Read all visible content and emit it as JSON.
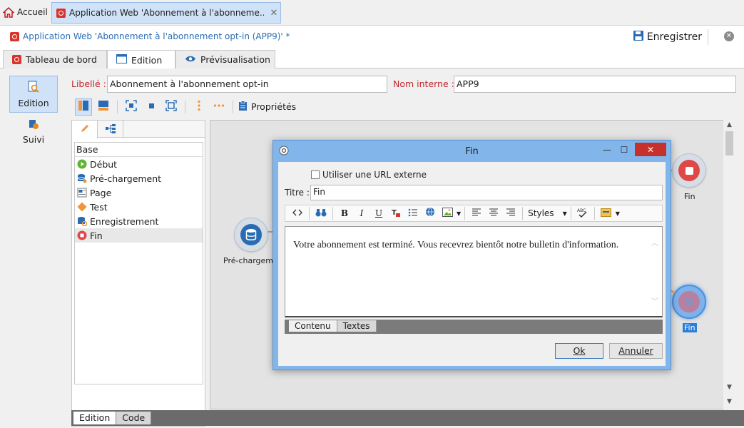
{
  "topbar": {
    "home_label": "Accueil",
    "tab_title": "Application Web 'Abonnement à l'abonneme...",
    "tab_close": "✕"
  },
  "titlebar": {
    "document_title": "Application Web 'Abonnement à l'abonnement opt-in (APP9)' *",
    "save_label": "Enregistrer"
  },
  "main_tabs": [
    {
      "label": "Tableau de bord",
      "icon": "dashboard-icon",
      "active": false
    },
    {
      "label": "Edition",
      "icon": "window-icon",
      "active": true
    },
    {
      "label": "Prévisualisation",
      "icon": "eye-icon",
      "active": false
    }
  ],
  "left_nav": [
    {
      "label": "Edition",
      "icon": "edit-search-icon",
      "active": true
    },
    {
      "label": "Suivi",
      "icon": "tracking-icon",
      "active": false
    }
  ],
  "form": {
    "libelle_label": "Libellé :",
    "libelle_value": "Abonnement à l'abonnement opt-in",
    "nom_interne_label": "Nom interne :",
    "nom_interne_value": "APP9"
  },
  "toolbar": {
    "properties_label": "Propriétés"
  },
  "activity_list": {
    "header": "Base",
    "items": [
      {
        "label": "Début",
        "icon": "start-icon"
      },
      {
        "label": "Pré-chargement",
        "icon": "preload-icon"
      },
      {
        "label": "Page",
        "icon": "page-icon"
      },
      {
        "label": "Test",
        "icon": "test-diamond-icon"
      },
      {
        "label": "Enregistrement",
        "icon": "save-record-icon"
      },
      {
        "label": "Fin",
        "icon": "end-icon",
        "selected": true
      }
    ]
  },
  "bottom_tabs": [
    {
      "label": "Edition",
      "active": true
    },
    {
      "label": "Code",
      "active": false
    }
  ],
  "canvas": {
    "node_preload_label": "Pré-chargeme",
    "node_end_top_label": "Fin",
    "node_end_selected_label": "Fin"
  },
  "dialog": {
    "title": "Fin",
    "minimize": "—",
    "maximize": "☐",
    "close": "✕",
    "external_url_label": "Utiliser une URL externe",
    "external_url_checked": false,
    "titre_label": "Titre :",
    "titre_value": "Fin",
    "styles_label": "Styles",
    "editor_text": "Votre abonnement est terminé. Vous recevrez bientôt notre bulletin d'information.",
    "editor_tabs": [
      {
        "label": "Contenu",
        "active": true
      },
      {
        "label": "Textes",
        "active": false
      }
    ],
    "ok_label": "Ok",
    "cancel_label": "Annuler"
  },
  "colors": {
    "accent_blue": "#2a6cb4",
    "required_red": "#c1272d",
    "selection_blue": "#cfe2f7",
    "arrow_orange": "#f0953b",
    "end_red": "#e04848"
  }
}
